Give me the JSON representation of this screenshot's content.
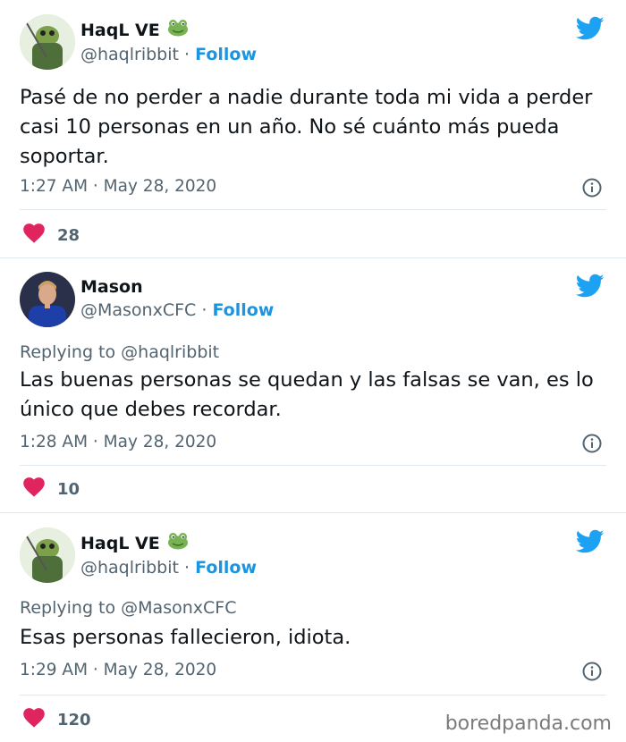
{
  "tweets": [
    {
      "name": "HaqL VE",
      "handle": "@haqlribbit",
      "follow_label": "Follow",
      "replying_to": "",
      "text": "Pasé de no perder a nadie durante toda mi vida a perder casi 10 personas en un año. No sé cuánto más pueda soportar.",
      "timestamp": "1:27 AM · May 28, 2020",
      "likes": "28"
    },
    {
      "name": "Mason",
      "handle": "@MasonxCFC",
      "follow_label": "Follow",
      "replying_to": "Replying to @haqlribbit",
      "text": "Las buenas personas se quedan y las falsas se van, es lo único que debes recordar.",
      "timestamp": "1:28 AM · May 28, 2020",
      "likes": "10"
    },
    {
      "name": "HaqL VE",
      "handle": "@haqlribbit",
      "follow_label": "Follow",
      "replying_to": "Replying to @MasonxCFC",
      "text": "Esas personas fallecieron, idiota.",
      "timestamp": "1:29 AM · May 28, 2020",
      "likes": "120"
    }
  ],
  "watermark": "boredpanda.com",
  "colors": {
    "twitter_blue": "#1da1f2",
    "follow": "#1b95e0",
    "heart": "#e0245e",
    "muted": "#536471"
  },
  "icons": {
    "brand": "twitter-bird-icon",
    "like": "heart-icon",
    "info": "info-icon",
    "badge": "frog-emoji"
  }
}
